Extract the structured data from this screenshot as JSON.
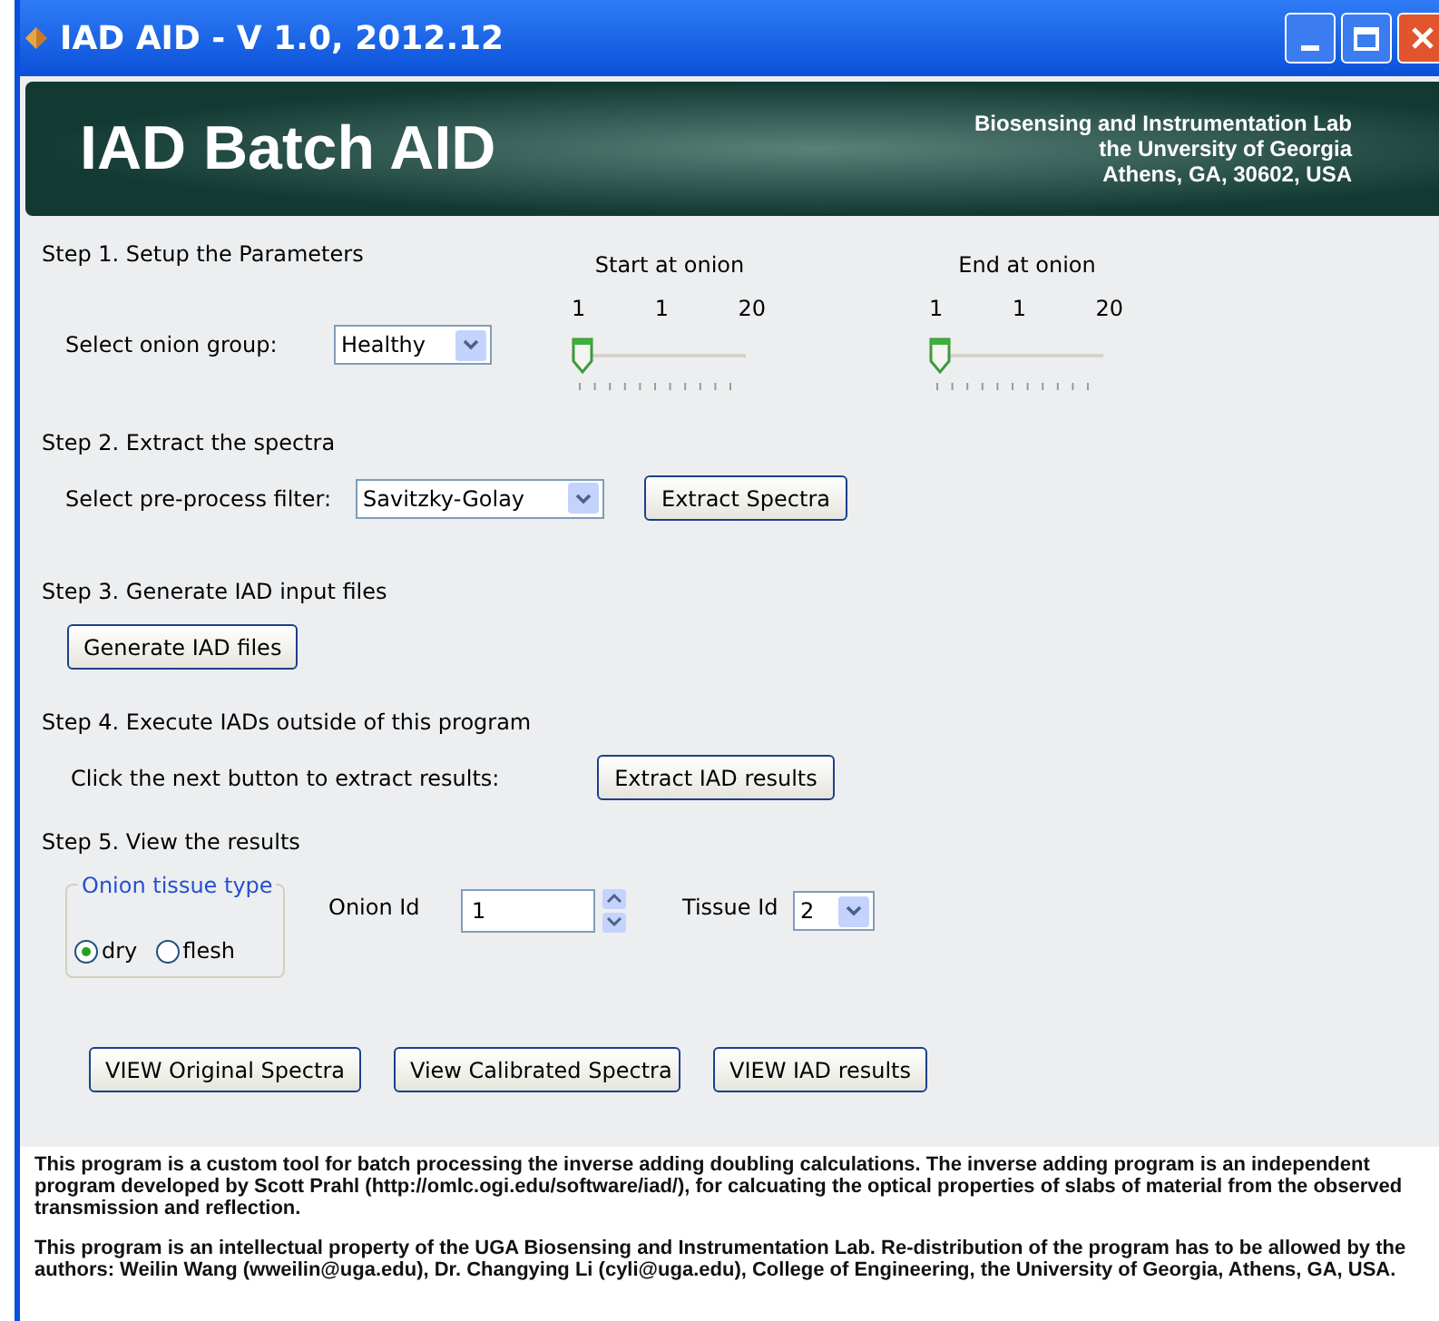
{
  "window": {
    "title": "IAD AID - V 1.0, 2012.12"
  },
  "banner": {
    "title": "IAD Batch AID",
    "lines": [
      "Biosensing and Instrumentation Lab",
      "the Unversity of Georgia",
      "Athens, GA, 30602, USA"
    ]
  },
  "step1": {
    "heading": "Step 1. Setup the Parameters",
    "group_label": "Select onion group:",
    "group_value": "Healthy",
    "sliders": [
      {
        "title": "Start at onion",
        "min": "1",
        "value": "1",
        "max": "20",
        "level": 0
      },
      {
        "title": "End at onion",
        "min": "1",
        "value": "1",
        "max": "20",
        "level": 0
      }
    ]
  },
  "step2": {
    "heading": "Step 2. Extract the spectra",
    "filter_label": "Select pre-process filter:",
    "filter_value": "Savitzky-Golay",
    "button": "Extract Spectra"
  },
  "step3": {
    "heading": "Step 3. Generate IAD input files",
    "button": "Generate IAD files"
  },
  "step4": {
    "heading": "Step 4. Execute IADs outside of this program",
    "label": "Click the next button to extract results:",
    "button": "Extract IAD results"
  },
  "step5": {
    "heading": "Step 5. View the results",
    "tissue_group": {
      "title": "Onion tissue type",
      "options": [
        {
          "label": "dry",
          "selected": true
        },
        {
          "label": "flesh",
          "selected": false
        }
      ]
    },
    "onion_id_label": "Onion Id",
    "onion_id_value": "1",
    "tissue_id_label": "Tissue Id",
    "tissue_id_value": "2",
    "buttons": [
      "VIEW Original Spectra",
      "View Calibrated Spectra",
      "VIEW IAD results"
    ]
  },
  "footer": [
    "This program is a custom tool for batch processing the inverse adding doubling calculations. The inverse adding program is an independent program developed by Scott Prahl (http://omlc.ogi.edu/software/iad/), for calcuating the optical properties of slabs of material from the observed transmission and reflection.",
    "This program is an intellectual property of the UGA Biosensing and Instrumentation Lab. Re-distribution of the program has to be allowed by the authors: Weilin Wang (wweilin@uga.edu), Dr. Changying Li (cyli@uga.edu), College of Engineering, the University of Georgia, Athens, GA, USA."
  ]
}
